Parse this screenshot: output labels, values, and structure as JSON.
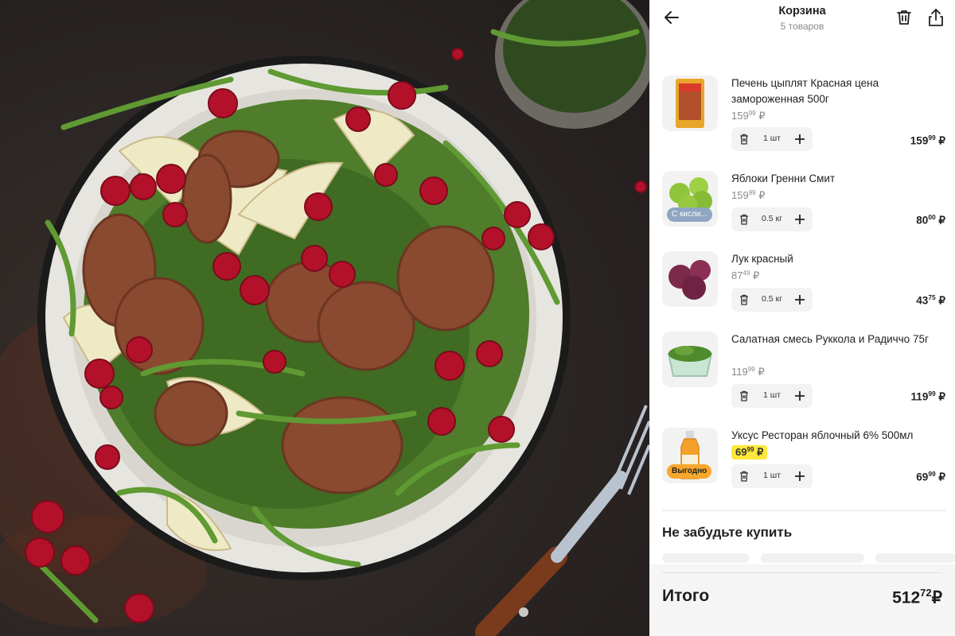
{
  "header": {
    "title": "Корзина",
    "subtitle": "5 товаров"
  },
  "items": [
    {
      "name": "Печень цыплят Красная цена замороженная 500г",
      "price_main": "159",
      "price_cents": "99",
      "currency": "₽",
      "qty": "1 шт",
      "total_main": "159",
      "total_cents": "99",
      "icon": "chicken-liver-pack-icon"
    },
    {
      "name": "Яблоки Гренни Смит",
      "price_main": "159",
      "price_cents": "99",
      "currency": "₽",
      "qty": "0.5 кг",
      "total_main": "80",
      "total_cents": "00",
      "badge": "С кисли...",
      "badge_color": "#8ea6c2",
      "icon": "green-apples-icon"
    },
    {
      "name": "Лук красный",
      "price_main": "87",
      "price_cents": "49",
      "currency": "₽",
      "qty": "0.5 кг",
      "total_main": "43",
      "total_cents": "75",
      "icon": "red-onion-icon"
    },
    {
      "name": "Салатная смесь Руккола и Радиччо 75г",
      "price_main": "119",
      "price_cents": "99",
      "currency": "₽",
      "qty": "1 шт",
      "total_main": "119",
      "total_cents": "99",
      "icon": "salad-box-icon"
    },
    {
      "name": "Уксус Ресторан яблочный 6% 500мл",
      "price_main": "69",
      "price_cents": "99",
      "currency": "₽",
      "qty": "1 шт",
      "total_main": "69",
      "total_cents": "99",
      "badge": "Выгодно",
      "badge_color": "#f7a72b",
      "price_highlight": "#ffe83a",
      "icon": "vinegar-bottle-icon"
    }
  ],
  "recommend": {
    "title": "Не забудьте купить"
  },
  "summary": {
    "label": "Итого",
    "total_main": "512",
    "total_cents": "72",
    "currency": "₽"
  },
  "icons": {
    "back": "arrow-left-icon",
    "clear": "trash-icon",
    "share": "share-icon",
    "remove": "trash-icon",
    "add": "plus-icon"
  },
  "colors": {
    "promo_yellow": "#ffe83a",
    "promo_orange": "#f7a72b",
    "stepper_bg": "#f3f3f3"
  }
}
